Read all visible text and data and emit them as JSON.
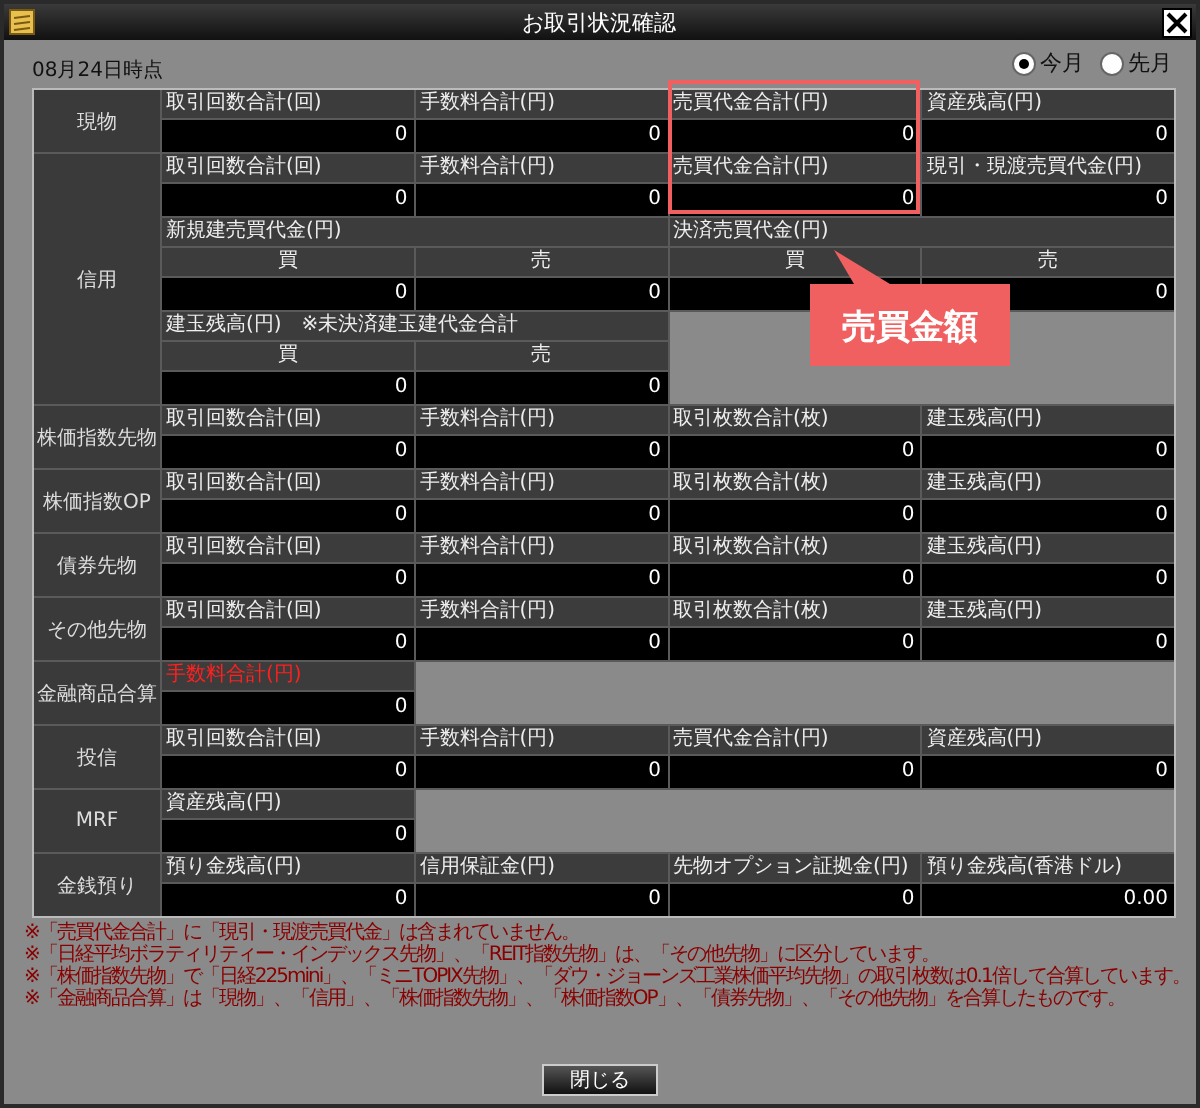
{
  "window": {
    "title": "お取引状況確認"
  },
  "as_of": "08月24日時点",
  "period_options": [
    {
      "label": "今月",
      "selected": true
    },
    {
      "label": "先月",
      "selected": false
    }
  ],
  "sections": [
    {
      "label": "現物",
      "kind": "simple",
      "cells": [
        {
          "header": "取引回数合計(回)",
          "value": "0"
        },
        {
          "header": "手数料合計(円)",
          "value": "0"
        },
        {
          "header": "売買代金合計(円)",
          "value": "0"
        },
        {
          "header": "資産残高(円)",
          "value": "0"
        }
      ]
    },
    {
      "label": "信用",
      "kind": "credit",
      "cells": [
        {
          "header": "取引回数合計(回)",
          "value": "0"
        },
        {
          "header": "手数料合計(円)",
          "value": "0"
        },
        {
          "header": "売買代金合計(円)",
          "value": "0"
        },
        {
          "header": "現引・現渡売買代金(円)",
          "value": "0"
        }
      ],
      "groups": [
        {
          "header": "新規建売買代金(円)",
          "sides": [
            {
              "header": "買",
              "value": "0"
            },
            {
              "header": "売",
              "value": "0"
            }
          ]
        },
        {
          "header": "決済売買代金(円)",
          "sides": [
            {
              "header": "買"
            },
            {
              "header": "売",
              "value": "0"
            }
          ]
        }
      ],
      "position": {
        "header": "建玉残高(円)　※未決済建玉建代金合計",
        "sides": [
          {
            "header": "買",
            "value": "0"
          },
          {
            "header": "売",
            "value": "0"
          }
        ]
      }
    },
    {
      "label": "株価指数先物",
      "kind": "simple",
      "cells": [
        {
          "header": "取引回数合計(回)",
          "value": "0"
        },
        {
          "header": "手数料合計(円)",
          "value": "0"
        },
        {
          "header": "取引枚数合計(枚)",
          "value": "0"
        },
        {
          "header": "建玉残高(円)",
          "value": "0"
        }
      ]
    },
    {
      "label": "株価指数OP",
      "kind": "simple",
      "cells": [
        {
          "header": "取引回数合計(回)",
          "value": "0"
        },
        {
          "header": "手数料合計(円)",
          "value": "0"
        },
        {
          "header": "取引枚数合計(枚)",
          "value": "0"
        },
        {
          "header": "建玉残高(円)",
          "value": "0"
        }
      ]
    },
    {
      "label": "債券先物",
      "kind": "simple",
      "cells": [
        {
          "header": "取引回数合計(回)",
          "value": "0"
        },
        {
          "header": "手数料合計(円)",
          "value": "0"
        },
        {
          "header": "取引枚数合計(枚)",
          "value": "0"
        },
        {
          "header": "建玉残高(円)",
          "value": "0"
        }
      ]
    },
    {
      "label": "その他先物",
      "kind": "simple",
      "cells": [
        {
          "header": "取引回数合計(回)",
          "value": "0"
        },
        {
          "header": "手数料合計(円)",
          "value": "0"
        },
        {
          "header": "取引枚数合計(枚)",
          "value": "0"
        },
        {
          "header": "建玉残高(円)",
          "value": "0"
        }
      ]
    },
    {
      "label": "金融商品合算",
      "kind": "simple",
      "cells": [
        {
          "header": "手数料合計(円)",
          "value": "0",
          "highlighted": true
        }
      ]
    },
    {
      "label": "投信",
      "kind": "simple",
      "cells": [
        {
          "header": "取引回数合計(回)",
          "value": "0"
        },
        {
          "header": "手数料合計(円)",
          "value": "0"
        },
        {
          "header": "売買代金合計(円)",
          "value": "0"
        },
        {
          "header": "資産残高(円)",
          "value": "0"
        }
      ]
    },
    {
      "label": "MRF",
      "kind": "simple",
      "cells": [
        {
          "header": "資産残高(円)",
          "value": "0"
        }
      ]
    },
    {
      "label": "金銭預り",
      "kind": "simple",
      "cells": [
        {
          "header": "預り金残高(円)",
          "value": "0"
        },
        {
          "header": "信用保証金(円)",
          "value": "0"
        },
        {
          "header": "先物オプション証拠金(円)",
          "value": "0"
        },
        {
          "header": "預り金残高(香港ドル)",
          "value": "0.00"
        }
      ]
    }
  ],
  "annotation": {
    "label": "売買金額"
  },
  "notes": [
    "※「売買代金合計」に「現引・現渡売買代金」は含まれていません。",
    "※「日経平均ボラティリティー・インデックス先物」、「REIT指数先物」は、「その他先物」に区分しています。",
    "※「株価指数先物」で「日経225mini」、「ミニTOPIX先物」、「ダウ・ジョーンズ工業株価平均先物」の取引枚数は0.1倍して合算しています。",
    "※「金融商品合算」は「現物」、「信用」、「株価指数先物」、「株価指数OP」、「債券先物」、「その他先物」を合算したものです。"
  ],
  "buttons": [
    "閉じる"
  ]
}
